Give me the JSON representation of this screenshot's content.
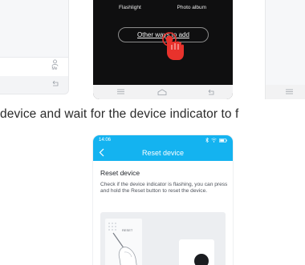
{
  "left_phone": {
    "tab_me_label": "Me"
  },
  "middle_phone": {
    "option_flashlight": "Flashlight",
    "option_photo_album": "Photo album",
    "other_ways_button": "Other ways to add"
  },
  "instruction_text": "device and wait for the device indicator to f",
  "bottom_phone": {
    "status_time": "14:06",
    "header_title": "Reset device",
    "section_heading": "Reset device",
    "description": "Check if the device indicator is flashing, you can press and hold the Reset button to reset the device.",
    "illustration_label": "RESET"
  },
  "colors": {
    "accent": "#14b3f0",
    "dark_screen": "#0f0f10",
    "hand_red": "#e8322c"
  }
}
